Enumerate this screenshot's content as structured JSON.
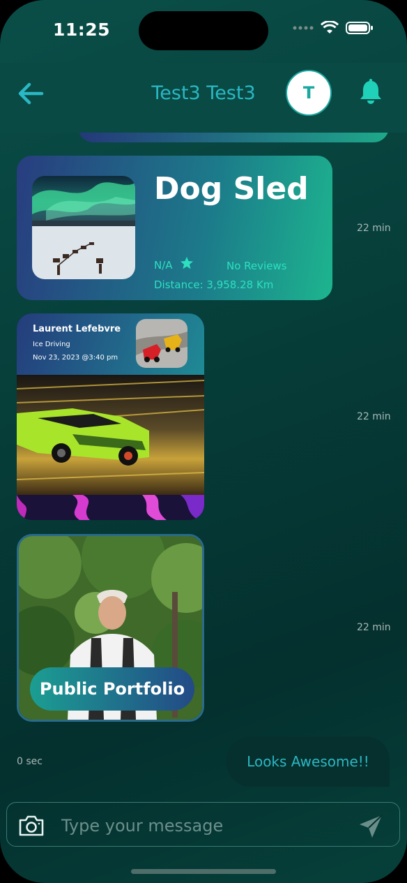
{
  "status": {
    "time": "11:25"
  },
  "header": {
    "title": "Test3 Test3",
    "avatar_initial": "T"
  },
  "messages": [
    {
      "kind": "experience",
      "title": "Dog Sled",
      "rating": "N/A",
      "reviews": "No Reviews",
      "distance": "Distance: 3,958.28 Km",
      "time": "22 min"
    },
    {
      "kind": "event",
      "author": "Laurent Lefebvre",
      "activity": "Ice Driving",
      "date": "Nov 23, 2023 @3:40 pm",
      "time": "22 min"
    },
    {
      "kind": "portfolio",
      "button_label": "Public Portfolio",
      "time": "22 min"
    },
    {
      "kind": "text",
      "text": "Looks Awesome!!",
      "time": "0 sec"
    }
  ],
  "composer": {
    "placeholder": "Type your message"
  },
  "colors": {
    "accent": "#2cb6c4",
    "teal": "#2de0c0",
    "background": "#063c38"
  },
  "icons": [
    "back-arrow-icon",
    "bell-icon",
    "star-icon",
    "camera-icon",
    "send-icon",
    "wifi-icon",
    "battery-icon",
    "signal-icon"
  ]
}
